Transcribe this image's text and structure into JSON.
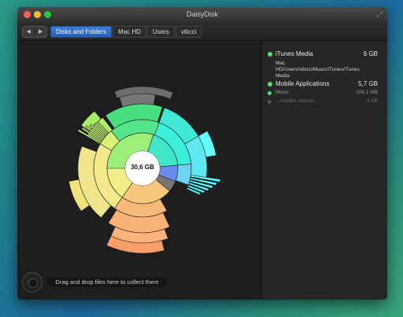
{
  "window": {
    "title": "DaisyDisk",
    "nav_back": "◀",
    "nav_forward": "▶",
    "fullscreen_icon": "⤢"
  },
  "breadcrumbs": [
    "Disks and Folders",
    "Mac HD",
    "Users",
    "viticci"
  ],
  "center_total": "30,6 GB",
  "drop_hint": "Drag and drop files here to collect them",
  "details": {
    "selected": {
      "name": "iTunes Media",
      "size": "6 GB",
      "color": "#52e06f",
      "path": "Mac HD/Users/viticci/Music/iTunes/iTunes Media"
    },
    "items": [
      {
        "name": "Mobile Applications",
        "size": "5,7 GB",
        "color": "#52e06f"
      },
      {
        "name": "Music",
        "size": "206,1 MB",
        "color": "#52e06f"
      },
      {
        "name": "...smaller objects...",
        "size": "4 KB",
        "color": "#555555"
      }
    ]
  },
  "colors": {
    "accent_blue": "#2e6fcb",
    "panel_bg": "#1e1e1e"
  }
}
